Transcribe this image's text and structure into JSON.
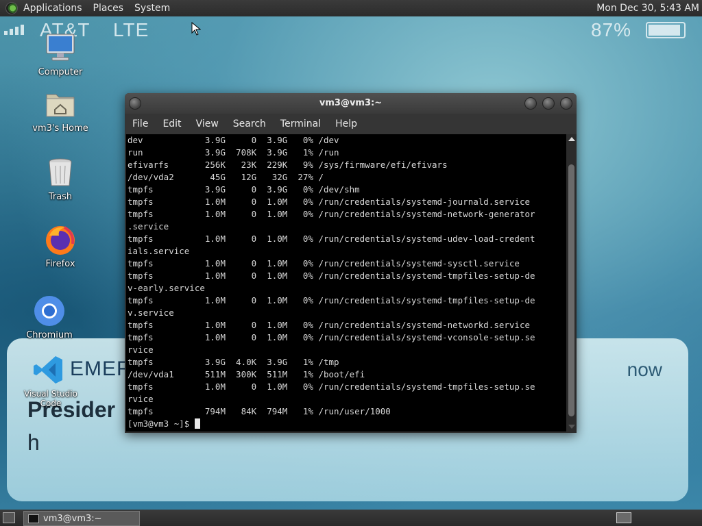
{
  "wallpaper": {
    "carrier": "AT&T",
    "network": "LTE",
    "battery": "87%",
    "card_title": "EMER",
    "card_time": "now",
    "card_line1": "Presider",
    "card_line2": "h"
  },
  "top_panel": {
    "menus": [
      "Applications",
      "Places",
      "System"
    ],
    "clock": "Mon Dec 30,  5:43 AM"
  },
  "desktop_icons": [
    {
      "label": "Computer",
      "icon": "computer-icon"
    },
    {
      "label": "vm3's Home",
      "icon": "home-folder-icon"
    },
    {
      "label": "Trash",
      "icon": "trash-icon"
    },
    {
      "label": "Firefox",
      "icon": "firefox-icon"
    },
    {
      "label": "Chromium",
      "icon": "chromium-icon"
    },
    {
      "label": "Visual Studio Code",
      "icon": "vscode-icon"
    }
  ],
  "terminal": {
    "title": "vm3@vm3:~",
    "menu": [
      "File",
      "Edit",
      "View",
      "Search",
      "Terminal",
      "Help"
    ],
    "lines": [
      "dev            3.9G     0  3.9G   0% /dev",
      "run            3.9G  708K  3.9G   1% /run",
      "efivarfs       256K   23K  229K   9% /sys/firmware/efi/efivars",
      "/dev/vda2       45G   12G   32G  27% /",
      "tmpfs          3.9G     0  3.9G   0% /dev/shm",
      "tmpfs          1.0M     0  1.0M   0% /run/credentials/systemd-journald.service",
      "tmpfs          1.0M     0  1.0M   0% /run/credentials/systemd-network-generator",
      ".service",
      "tmpfs          1.0M     0  1.0M   0% /run/credentials/systemd-udev-load-credent",
      "ials.service",
      "tmpfs          1.0M     0  1.0M   0% /run/credentials/systemd-sysctl.service",
      "tmpfs          1.0M     0  1.0M   0% /run/credentials/systemd-tmpfiles-setup-de",
      "v-early.service",
      "tmpfs          1.0M     0  1.0M   0% /run/credentials/systemd-tmpfiles-setup-de",
      "v.service",
      "tmpfs          1.0M     0  1.0M   0% /run/credentials/systemd-networkd.service",
      "tmpfs          1.0M     0  1.0M   0% /run/credentials/systemd-vconsole-setup.se",
      "rvice",
      "tmpfs          3.9G  4.0K  3.9G   1% /tmp",
      "/dev/vda1      511M  300K  511M   1% /boot/efi",
      "tmpfs          1.0M     0  1.0M   0% /run/credentials/systemd-tmpfiles-setup.se",
      "rvice",
      "tmpfs          794M   84K  794M   1% /run/user/1000"
    ],
    "prompt": "[vm3@vm3 ~]$ "
  },
  "bottom_panel": {
    "task_label": "vm3@vm3:~"
  }
}
